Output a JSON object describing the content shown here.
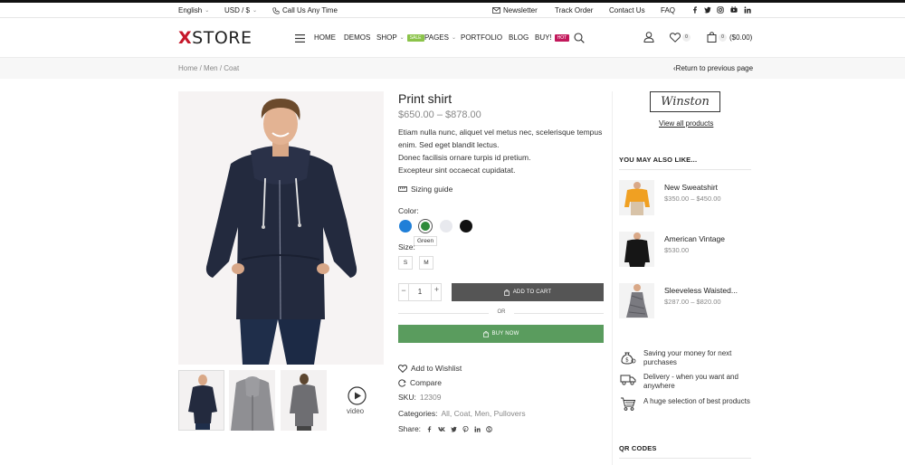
{
  "topbar": {
    "language": "English",
    "currency": "USD / $",
    "call": "Call Us Any Time",
    "newsletter": "Newsletter",
    "track_order": "Track Order",
    "contact": "Contact Us",
    "faq": "FAQ"
  },
  "header": {
    "logo_x": "X",
    "logo_rest": "STORE",
    "nav": [
      "HOME",
      "DEMOS",
      "SHOP",
      "PAGES",
      "PORTFOLIO",
      "BLOG",
      "BUY!"
    ],
    "shop_badge": "SALE",
    "buy_badge": "HOT",
    "wishlist_count": "0",
    "cart_count": "0",
    "cart_total": "($0.00)"
  },
  "breadcrumb": {
    "items": [
      "Home",
      "Men",
      "Coat"
    ],
    "back": "Return to previous page"
  },
  "product": {
    "title": "Print shirt",
    "price": "$650.00 – $878.00",
    "desc_1": "Etiam nulla nunc, aliquet vel metus nec, scelerisque tempus enim. Sed eget blandit lectus.",
    "desc_2": "Donec facilisis ornare turpis id pretium.",
    "desc_3": "Excepteur sint occaecat cupidatat.",
    "sizing_guide": "Sizing guide",
    "color_label": "Color:",
    "colors": [
      "#1f7fd8",
      "#2e8b3a",
      "#e8e9ee",
      "#111111"
    ],
    "color_tooltip": "Green",
    "size_label": "Size:",
    "sizes": [
      "S",
      "M"
    ],
    "quantity": "1",
    "qty_minus": "−",
    "qty_plus": "+",
    "add_to_cart": "ADD TO CART",
    "or": "OR",
    "buy_now": "BUY NOW",
    "wishlist": "Add to Wishlist",
    "compare": "Compare",
    "sku_label": "SKU:",
    "sku": "12309",
    "categories_label": "Categories:",
    "categories": [
      "All",
      "Coat",
      "Men",
      "Pullovers"
    ],
    "share_label": "Share:",
    "video_label": "video",
    "accent_green": "#5a9c5e",
    "cart_button_color": "#555555"
  },
  "sidebar": {
    "brand": "Winston",
    "view_all": "View all products",
    "also_like": "YOU MAY ALSO LIKE...",
    "products": [
      {
        "name": "New Sweatshirt",
        "price": "$350.00 – $450.00"
      },
      {
        "name": "American Vintage",
        "price": "$530.00"
      },
      {
        "name": "Sleeveless Waisted...",
        "price": "$287.00 – $820.00"
      }
    ],
    "features": [
      "Saving your money for next purchases",
      "Delivery - when you want and anywhere",
      "A huge selection of best products"
    ],
    "qr": "QR CODES"
  }
}
